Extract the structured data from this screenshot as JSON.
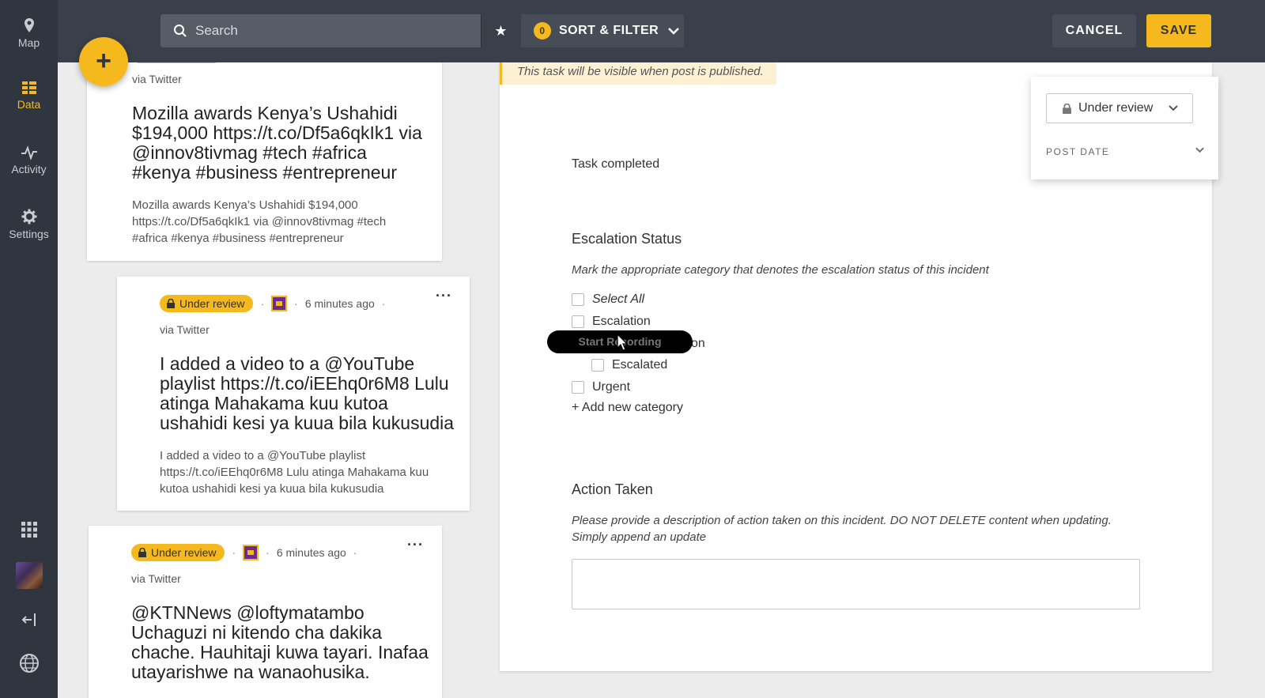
{
  "sidebar": {
    "items": [
      {
        "label": "Map",
        "icon": "map-pin-icon"
      },
      {
        "label": "Data",
        "icon": "data-list-icon",
        "active": true
      },
      {
        "label": "Activity",
        "icon": "activity-icon"
      },
      {
        "label": "Settings",
        "icon": "gear-icon"
      }
    ]
  },
  "topbar": {
    "search_placeholder": "Search",
    "filter_count": "0",
    "sort_filter_label": "SORT & FILTER",
    "cancel_label": "CANCEL",
    "save_label": "SAVE"
  },
  "fab": {
    "label": "+"
  },
  "feed": {
    "posts": [
      {
        "via": "via Twitter",
        "title": "Mozilla awards Kenya’s Ushahidi $194,000 https://t.co/Df5a6qkIk1 via @innov8tivmag #tech #africa #kenya #business #entrepreneur",
        "body": "Mozilla awards Kenya’s Ushahidi $194,000 https://t.co/Df5a6qkIk1 via @innov8tivmag #tech #africa #kenya #business #entrepreneur"
      },
      {
        "status": "Under review",
        "time": "6 minutes ago",
        "via": "via Twitter",
        "title": "I added a video to a @YouTube playlist https://t.co/iEEhq0r6M8 Lulu atinga Mahakama kuu kutoa ushahidi kesi ya kuua bila kukusudia",
        "body": "I added a video to a @YouTube playlist https://t.co/iEEhq0r6M8 Lulu atinga Mahakama kuu kutoa ushahidi kesi ya kuua bila kukusudia"
      },
      {
        "status": "Under review",
        "time": "6 minutes ago",
        "via": "via Twitter",
        "title": "@KTNNews @loftymatambo Uchaguzi ni kitendo cha dakika chache. Hauhitaji kuwa tayari. Inafaa utayarishwe na wanaohusika."
      }
    ]
  },
  "detail": {
    "notice": "This task will be visible when post is published.",
    "task_completed": "Task completed",
    "escalation": {
      "title": "Escalation Status",
      "description": "Mark the appropriate category that denotes the escalation status of this incident",
      "options": [
        "Select All",
        "Escalation",
        "on",
        "Escalated",
        "Urgent"
      ],
      "add_category": "+ Add new category"
    },
    "action": {
      "title": "Action Taken",
      "description": "Please provide a description of action taken on this incident. DO NOT DELETE content when updating. Simply append an update",
      "value": ""
    }
  },
  "status_panel": {
    "status": "Under review",
    "post_date_label": "POST DATE"
  },
  "overlay": {
    "recording_label": "Start Recording"
  },
  "colors": {
    "accent": "#f6b91d",
    "sidebar_bg": "#2f3640",
    "topbar_bg": "#3a4049"
  }
}
